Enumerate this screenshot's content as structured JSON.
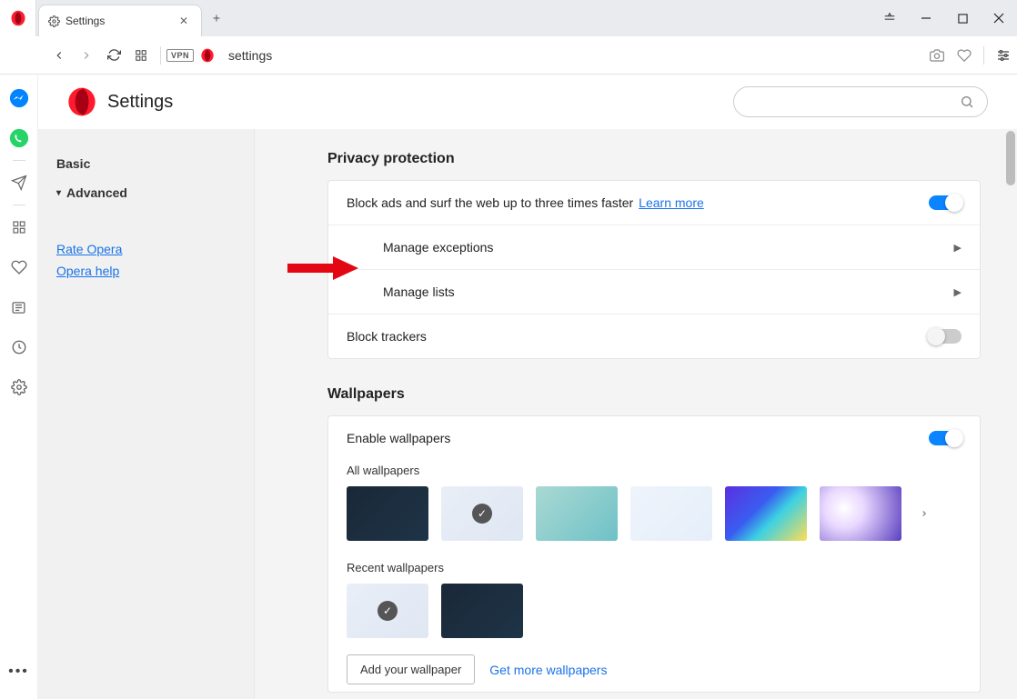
{
  "window": {
    "tab_title": "Settings"
  },
  "addressbar": {
    "vpn_label": "VPN",
    "url": "settings"
  },
  "settings": {
    "title": "Settings",
    "search_placeholder": ""
  },
  "sidebar": {
    "basic": "Basic",
    "advanced": "Advanced",
    "rate": "Rate Opera",
    "help": "Opera help"
  },
  "privacy": {
    "heading": "Privacy protection",
    "block_ads_label": "Block ads and surf the web up to three times faster",
    "learn_more": "Learn more",
    "manage_exceptions": "Manage exceptions",
    "manage_lists": "Manage lists",
    "block_trackers": "Block trackers"
  },
  "wallpapers": {
    "heading": "Wallpapers",
    "enable": "Enable wallpapers",
    "all": "All wallpapers",
    "recent": "Recent wallpapers",
    "add_btn": "Add your wallpaper",
    "get_more": "Get more wallpapers"
  }
}
